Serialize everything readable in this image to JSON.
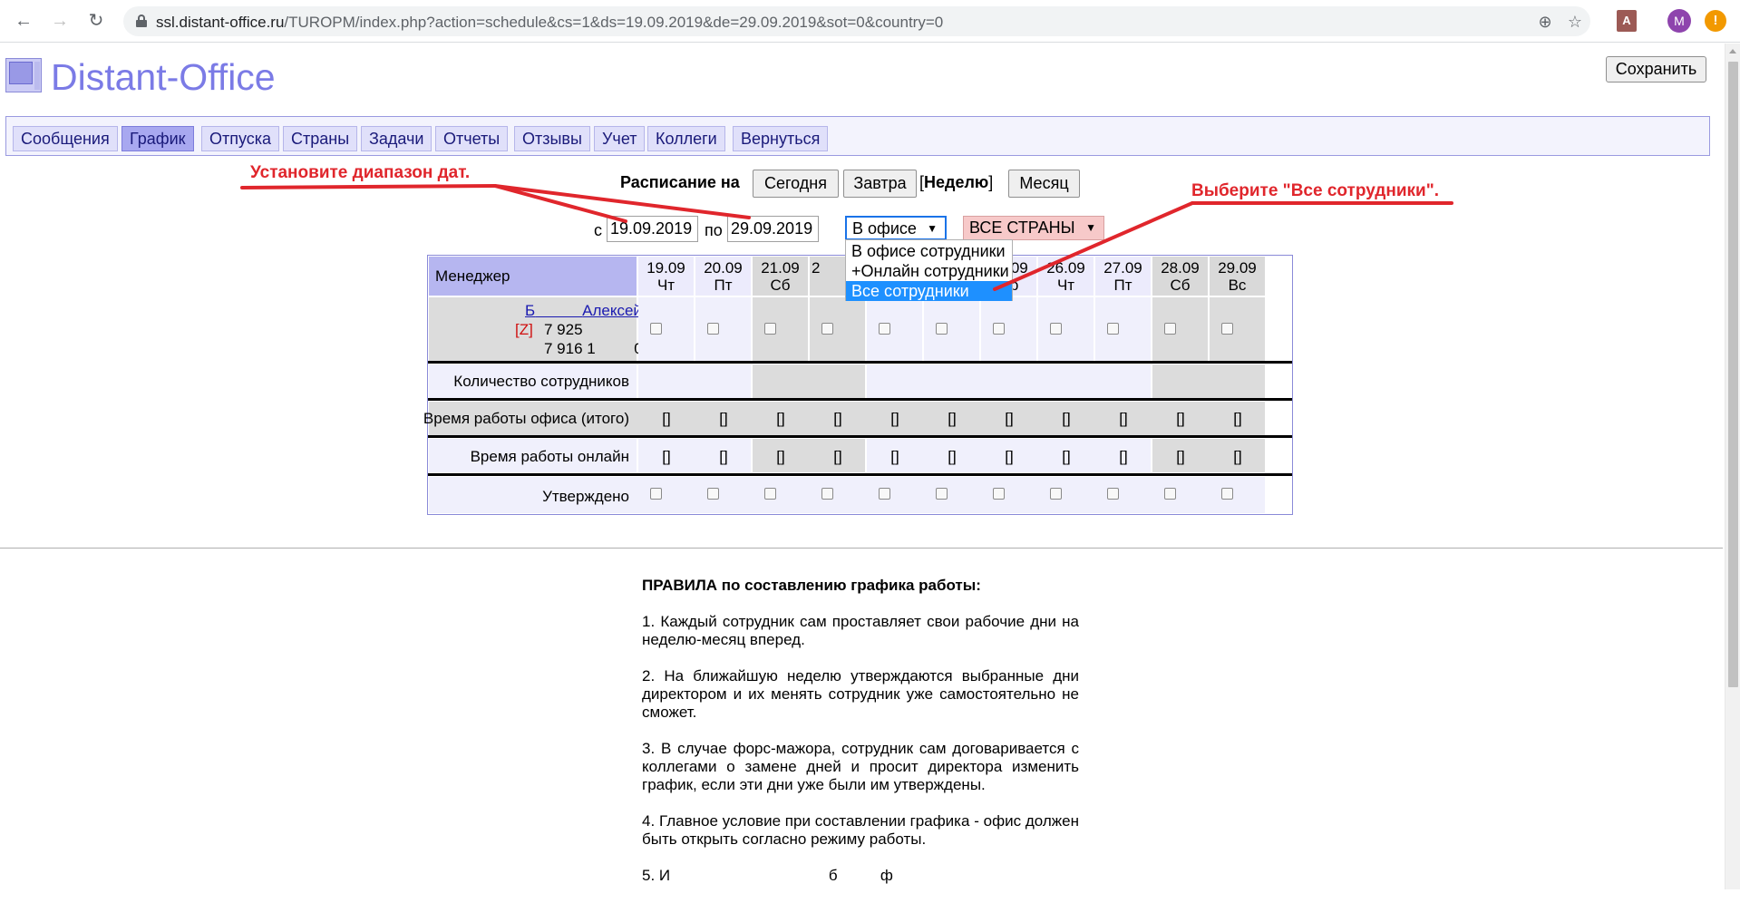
{
  "browser": {
    "url_host": "ssl.distant-office.ru",
    "url_rest": "/TUROPM/index.php?action=schedule&cs=1&ds=19.09.2019&de=29.09.2019&sot=0&country=0",
    "back_icon": "←",
    "forward_icon": "→",
    "reload_icon": "↻",
    "zoom_icon": "⊕",
    "star_icon": "☆",
    "pdf_ext_label": "A",
    "profile_initial": "M",
    "update_icon": "!"
  },
  "header": {
    "logo_text": "Distant-Office",
    "save_label": "Сохранить"
  },
  "menu": [
    {
      "label": "Сообщения"
    },
    {
      "label": "График"
    },
    {
      "label": "Отпуска"
    },
    {
      "label": "Страны"
    },
    {
      "label": "Задачи"
    },
    {
      "label": "Отчеты"
    },
    {
      "label": "Отзывы"
    },
    {
      "label": "Учет"
    },
    {
      "label": "Коллеги"
    },
    {
      "label": "Вернуться"
    }
  ],
  "schedule_controls": {
    "label": "Расписание на",
    "today": "Сегодня",
    "tomorrow": "Завтра",
    "bracket_open": "[",
    "week": "Неделю",
    "bracket_close": "]",
    "month": "Месяц",
    "from_label": "с",
    "from_value": "19.09.2019",
    "to_label": "по",
    "to_value": "29.09.2019",
    "office_select_value": "В офисе",
    "country_select_value": "ВСЕ СТРАНЫ",
    "dropdown_options": [
      "В офисе сотрудники",
      "+Онлайн сотрудники",
      "Все сотрудники"
    ]
  },
  "table": {
    "manager_header": "Менеджер",
    "days": [
      {
        "date": "19.09",
        "dow": "Чт"
      },
      {
        "date": "20.09",
        "dow": "Пт"
      },
      {
        "date": "21.09",
        "dow": "Сб"
      },
      {
        "date": "2",
        "dow": ""
      },
      {
        "date": "",
        "dow": ""
      },
      {
        "date": "",
        "dow": ""
      },
      {
        "date": "25.09",
        "dow": "Ср"
      },
      {
        "date": "26.09",
        "dow": "Чт"
      },
      {
        "date": "27.09",
        "dow": "Пт"
      },
      {
        "date": "28.09",
        "dow": "Сб"
      },
      {
        "date": "29.09",
        "dow": "Вс"
      }
    ],
    "manager_first": "Б",
    "manager_last": "Алексей",
    "z_badge": "[Z]",
    "phone1": "7 925",
    "phone2": "7 916 1         0",
    "row_count": "Количество сотрудников",
    "row_office_time": "Время работы офиса (итого)",
    "row_online_time": "Время работы онлайн",
    "row_approved": "Утверждено",
    "bracket_value": "[]"
  },
  "rules": {
    "title": "ПРАВИЛА по составлению графика работы:",
    "items": [
      "1. Каждый сотрудник сам проставляет свои рабочие дни на неделю-месяц вперед.",
      "2. На ближайшую неделю утверждаются выбранные дни директором и их менять сотрудник уже самостоятельно не сможет.",
      "3. В случае форс-мажора, сотрудник сам договаривается с коллегами о замене дней и просит директора изменить график, если эти дни уже были им утверждены.",
      "4. Главное условие при составлении графика - офис должен быть открыть согласно режиму работы.",
      "5. И                                     б          ф"
    ]
  },
  "annotations": {
    "date_range": "Установите диапазон дат.",
    "all_staff": "Выберите \"Все сотрудники\"."
  },
  "colors": {
    "accent": "#7b7be6",
    "annotation": "#e0262c",
    "selected_option": "#1e90ff",
    "header_bg": "#b6b6f0"
  }
}
